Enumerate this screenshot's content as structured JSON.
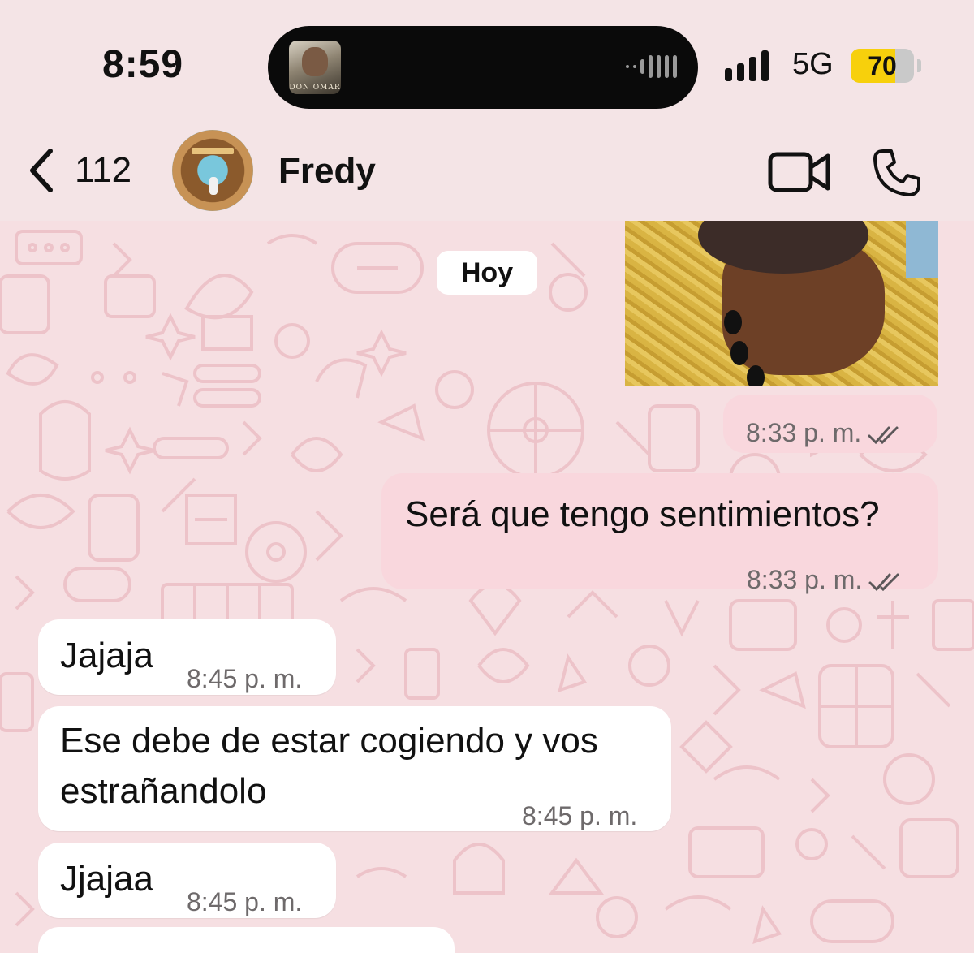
{
  "status_bar": {
    "time": "8:59",
    "now_playing_art_text": "DON OMAR",
    "network": "5G",
    "battery": "70",
    "battery_level": 0.7
  },
  "header": {
    "back_count": "112",
    "contact_name": "Fredy"
  },
  "chat": {
    "date_separator": "Hoy",
    "media_message": {
      "time": "8:33 p. m."
    },
    "messages": [
      {
        "direction": "outgoing",
        "text": "Será que tengo sentimientos?",
        "time": "8:33 p. m."
      },
      {
        "direction": "incoming",
        "text": "Jajaja",
        "time": "8:45 p. m."
      },
      {
        "direction": "incoming",
        "text_line1": "Ese debe de estar cogiendo y vos",
        "text_line2": "estrañandolo",
        "time": "8:45 p. m."
      },
      {
        "direction": "incoming",
        "text": "Jjajaa",
        "time": "8:45 p. m."
      }
    ]
  },
  "colors": {
    "wallpaper": "#f6dfe2",
    "outgoing_bubble": "#f9d7dd",
    "incoming_bubble": "#ffffff",
    "battery_fill": "#f7d00c"
  }
}
